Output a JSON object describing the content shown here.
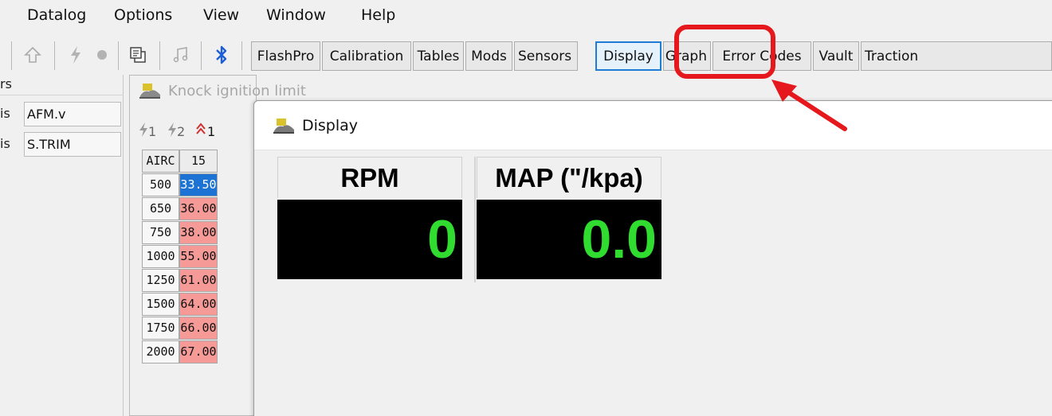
{
  "menubar": {
    "items": [
      "Datalog",
      "Options",
      "View",
      "Window",
      "Help"
    ]
  },
  "toolbar": {
    "icons": [
      "up-arrow-icon",
      "lightning-icon",
      "record-dot-icon",
      "copy-icon",
      "music-note-icon",
      "bluetooth-icon"
    ],
    "buttons": [
      "FlashPro",
      "Calibration",
      "Tables",
      "Mods",
      "Sensors",
      "Display",
      "Graph",
      "Error Codes",
      "Vault",
      "Traction"
    ],
    "active_button": "Display"
  },
  "left_panel": {
    "header": "rs",
    "rows": [
      {
        "prefix": "is",
        "value": "AFM.v"
      },
      {
        "prefix": "is",
        "value": "S.TRIM"
      }
    ]
  },
  "knock_window": {
    "title": "Knock ignition limit",
    "toolbar_labels": [
      "1",
      "2",
      "1"
    ],
    "column_headers": [
      "AIRC",
      "15"
    ],
    "rows": [
      {
        "airc": "500",
        "value": "33.50",
        "selected": true
      },
      {
        "airc": "650",
        "value": "36.00"
      },
      {
        "airc": "750",
        "value": "38.00"
      },
      {
        "airc": "1000",
        "value": "55.00"
      },
      {
        "airc": "1250",
        "value": "61.00"
      },
      {
        "airc": "1500",
        "value": "64.00"
      },
      {
        "airc": "1750",
        "value": "66.00"
      },
      {
        "airc": "2000",
        "value": "67.00"
      }
    ]
  },
  "display_window": {
    "title": "Display",
    "gauges": [
      {
        "label": "RPM",
        "value": "0"
      },
      {
        "label": "MAP (\"/kpa)",
        "value": "0.0"
      }
    ]
  },
  "colors": {
    "highlight": "#e5191d",
    "gauge_text": "#2fdc2f",
    "cell_value": "#f59a97",
    "cell_selected": "#1d73d4"
  }
}
